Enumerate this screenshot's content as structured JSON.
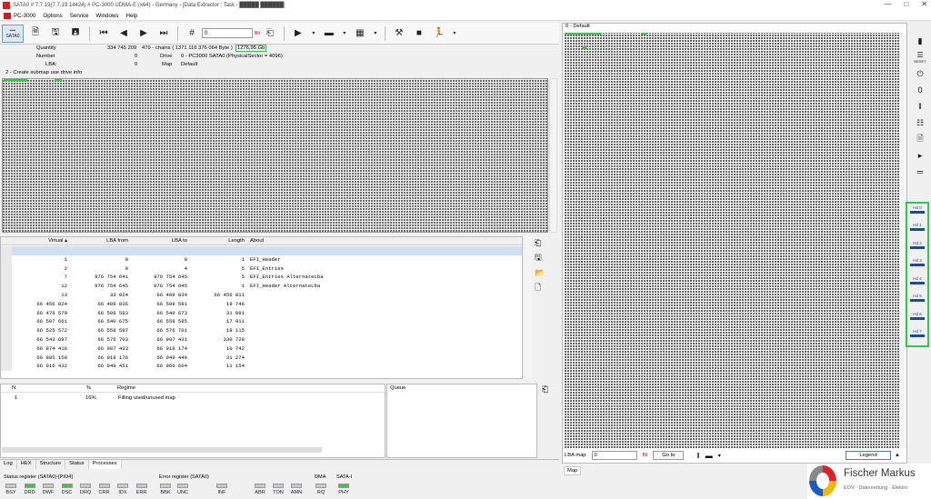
{
  "window": {
    "title": "SATA0 # 7.7.19(7.7.19.14424) # PC-3000 UDMA-E (x64) - Germany - [Data Extractor : Task - █████ ██████]",
    "min": "—",
    "max": "□",
    "close": "✕"
  },
  "menu": [
    "PC-3000",
    "Options",
    "Service",
    "Windows",
    "Help"
  ],
  "toolbar": {
    "sata_label": "SATA0",
    "lba_value": "0",
    "lba_unit": "Bit"
  },
  "info": {
    "quantity_label": "Quantity",
    "quantity_value": "334 745 209",
    "chains": "479 - chains ( 1371 116 376 064 Byte )",
    "capacity": "1276,95 Gb",
    "number_label": "Number",
    "number_value": "0",
    "lba_label": "LBA:",
    "lba_value": "0",
    "drive_label": "Drive",
    "drive_value": "0 - PC3000 SATA0 (PhysicalSector = 4096)",
    "map_label": "Map",
    "map_value": "Default"
  },
  "submap_label": "2 - Create submap use drive info",
  "table": {
    "headers": {
      "virtual": "Virtual ▴",
      "from": "LBA from",
      "to": "LBA to",
      "length": "Length",
      "about": "About"
    },
    "rows": [
      {
        "virtual": "",
        "from": "",
        "to": "",
        "length": "",
        "about": ""
      },
      {
        "virtual": "1",
        "from": "0",
        "to": "0",
        "length": "1",
        "about": "EFI_Header"
      },
      {
        "virtual": "2",
        "from": "0",
        "to": "4",
        "length": "5",
        "about": "EFI_Entries"
      },
      {
        "virtual": "7",
        "from": "976 754 641",
        "to": "976 754 645",
        "length": "5",
        "about": "EFI_Entries AlternateLba"
      },
      {
        "virtual": "12",
        "from": "976 754 645",
        "to": "976 754 645",
        "length": "1",
        "about": "EFI_Header AlternateLba"
      },
      {
        "virtual": "13",
        "from": "33 024",
        "to": "66 489 834",
        "length": "66 456 811",
        "about": ""
      },
      {
        "virtual": "66 456 824",
        "from": "66 489 836",
        "to": "66 509 581",
        "length": "19 746",
        "about": ""
      },
      {
        "virtual": "66 476 570",
        "from": "66 509 583",
        "to": "66 540 673",
        "length": "31 091",
        "about": ""
      },
      {
        "virtual": "66 507 661",
        "from": "66 540 675",
        "to": "66 558 585",
        "length": "17 911",
        "about": ""
      },
      {
        "virtual": "66 525 572",
        "from": "66 558 587",
        "to": "66 576 701",
        "length": "18 115",
        "about": ""
      },
      {
        "virtual": "66 543 687",
        "from": "66 576 703",
        "to": "66 907 431",
        "length": "330 729",
        "about": ""
      },
      {
        "virtual": "66 874 416",
        "from": "66 907 433",
        "to": "66 918 174",
        "length": "10 742",
        "about": ""
      },
      {
        "virtual": "66 885 158",
        "from": "66 918 176",
        "to": "66 949 449",
        "length": "31 274",
        "about": ""
      },
      {
        "virtual": "66 916 432",
        "from": "66 949 451",
        "to": "66 960 604",
        "length": "11 154",
        "about": ""
      }
    ]
  },
  "processes": {
    "headers": {
      "n": "N",
      "pct": "%",
      "regime": "Regime"
    },
    "row": {
      "n": "1",
      "pct": "16%",
      "regime": "Filling used/unused map"
    }
  },
  "queue_label": "Queue",
  "tabs": [
    "Log",
    "HEX",
    "Structure",
    "Status",
    "Processes"
  ],
  "status": {
    "status_title": "Status register (SATA0)-[PIO4]",
    "status_leds": [
      {
        "label": "BSY",
        "on": false
      },
      {
        "label": "DRD",
        "on": true
      },
      {
        "label": "DWF",
        "on": false
      },
      {
        "label": "DSC",
        "on": true
      },
      {
        "label": "DRQ",
        "on": false
      },
      {
        "label": "CRR",
        "on": false
      },
      {
        "label": "IDX",
        "on": false
      },
      {
        "label": "ERR",
        "on": false
      }
    ],
    "error_title": "Error register (SATA0)",
    "error_leds": [
      {
        "label": "BBK",
        "on": false
      },
      {
        "label": "UNC",
        "on": false
      },
      {
        "label": "INF",
        "on": false
      },
      {
        "label": "ABR",
        "on": false
      },
      {
        "label": "TON",
        "on": false
      },
      {
        "label": "AMN",
        "on": false
      }
    ],
    "dma_title": "DMA",
    "dma_led": {
      "label": "RQ",
      "on": false
    },
    "sata_title": "SATA-I",
    "sata_led": {
      "label": "PHY",
      "on": true
    }
  },
  "right_panel": {
    "title": "0 - Default",
    "lba_map_label": "LBA map",
    "lba_map_value": "0",
    "lba_unit": "Bit",
    "goto_label": "Go to",
    "legend_label": "Legend",
    "map_tab": "Map"
  },
  "right_toolbar": {
    "reset_label": "RESET",
    "heads": [
      "Hd 0",
      "Hd 1",
      "Hd 2",
      "Hd 3",
      "Hd 4",
      "Hd 5",
      "Hd 6",
      "Hd 7"
    ]
  },
  "watermark": {
    "name": "Fischer Markus",
    "subtitle": "EOV · Datenrettung · Elektro"
  },
  "colors": {
    "highlight": "#2ecc40",
    "map_cell": "#6f6f6f",
    "selection": "#cfe0f5"
  }
}
